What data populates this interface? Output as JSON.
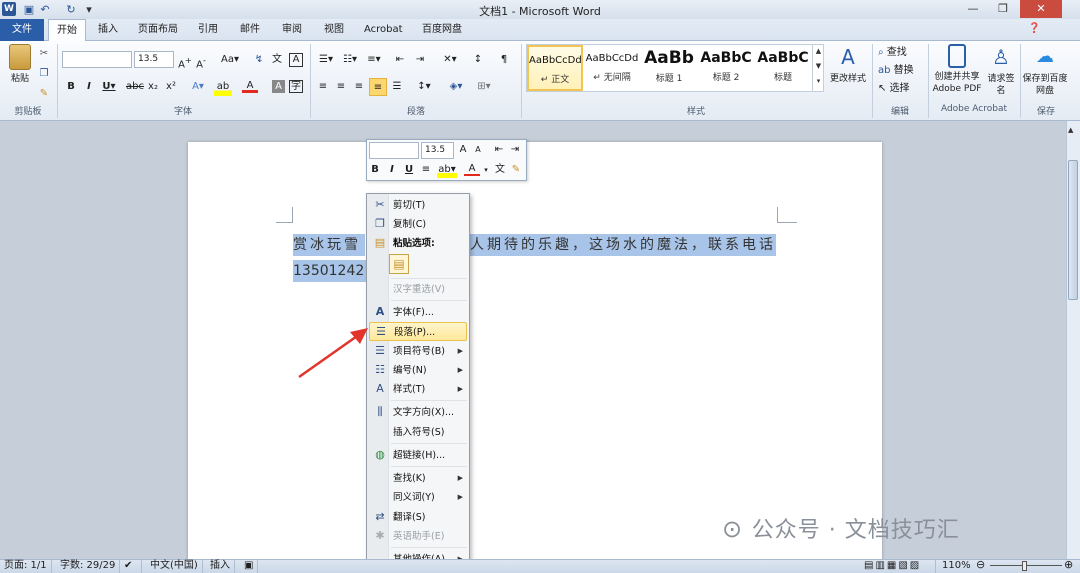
{
  "window": {
    "title": "文档1 - Microsoft Word"
  },
  "tabs": {
    "file": "文件",
    "items": [
      "开始",
      "插入",
      "页面布局",
      "引用",
      "邮件",
      "审阅",
      "视图",
      "Acrobat",
      "百度网盘"
    ]
  },
  "ribbon": {
    "clipboard": {
      "paste": "粘贴",
      "label": "剪贴板"
    },
    "font": {
      "name_value": "",
      "size_value": "13.5",
      "label": "字体"
    },
    "paragraph": {
      "label": "段落"
    },
    "styles": {
      "label": "样式",
      "change": "更改样式",
      "tiles": [
        {
          "sample": "AaBbCcDd",
          "name": "↵ 正文"
        },
        {
          "sample": "AaBbCcDd",
          "name": "↵ 无间隔"
        },
        {
          "sample": "AaBb",
          "name": "标题 1"
        },
        {
          "sample": "AaBbC",
          "name": "标题 2"
        },
        {
          "sample": "AaBbC",
          "name": "标题"
        }
      ]
    },
    "editing": {
      "find": "查找",
      "replace": "替换",
      "select": "选择",
      "label": "编辑"
    },
    "acrobat": {
      "create": "创建并共享 Adobe PDF",
      "sign": "请求签名",
      "label": "Adobe Acrobat"
    },
    "save": {
      "btn": "保存到百度网盘",
      "label": "保存"
    }
  },
  "document": {
    "line1_left": "赏冰玩雪",
    "line1_right": "人期待的乐趣，这场水的魔法，联系电话",
    "line2": "13501242"
  },
  "minitoolbar": {
    "font_size": "13.5"
  },
  "context_menu": {
    "cut": "剪切(T)",
    "copy": "复制(C)",
    "paste_options": "粘贴选项:",
    "reconvert": "汉字重选(V)",
    "font": "字体(F)...",
    "paragraph": "段落(P)...",
    "bullets": "项目符号(B)",
    "numbering": "编号(N)",
    "styles": "样式(T)",
    "text_direction": "文字方向(X)...",
    "insert_symbol": "插入符号(S)",
    "hyperlink": "超链接(H)...",
    "lookup": "查找(K)",
    "synonyms": "同义词(Y)",
    "translate": "翻译(S)",
    "english_assistant": "英语助手(E)",
    "more_actions": "其他操作(A)"
  },
  "status": {
    "page": "页面: 1/1",
    "words": "字数: 29/29",
    "language": "中文(中国)",
    "insert": "插入",
    "zoom": "110%"
  },
  "watermark": "公众号 · 文档技巧汇",
  "colors": {
    "file_tab": "#2a5ea8",
    "selection": "#a8c4e8",
    "highlight": "#ffe89a",
    "arrow": "#e2342a"
  }
}
